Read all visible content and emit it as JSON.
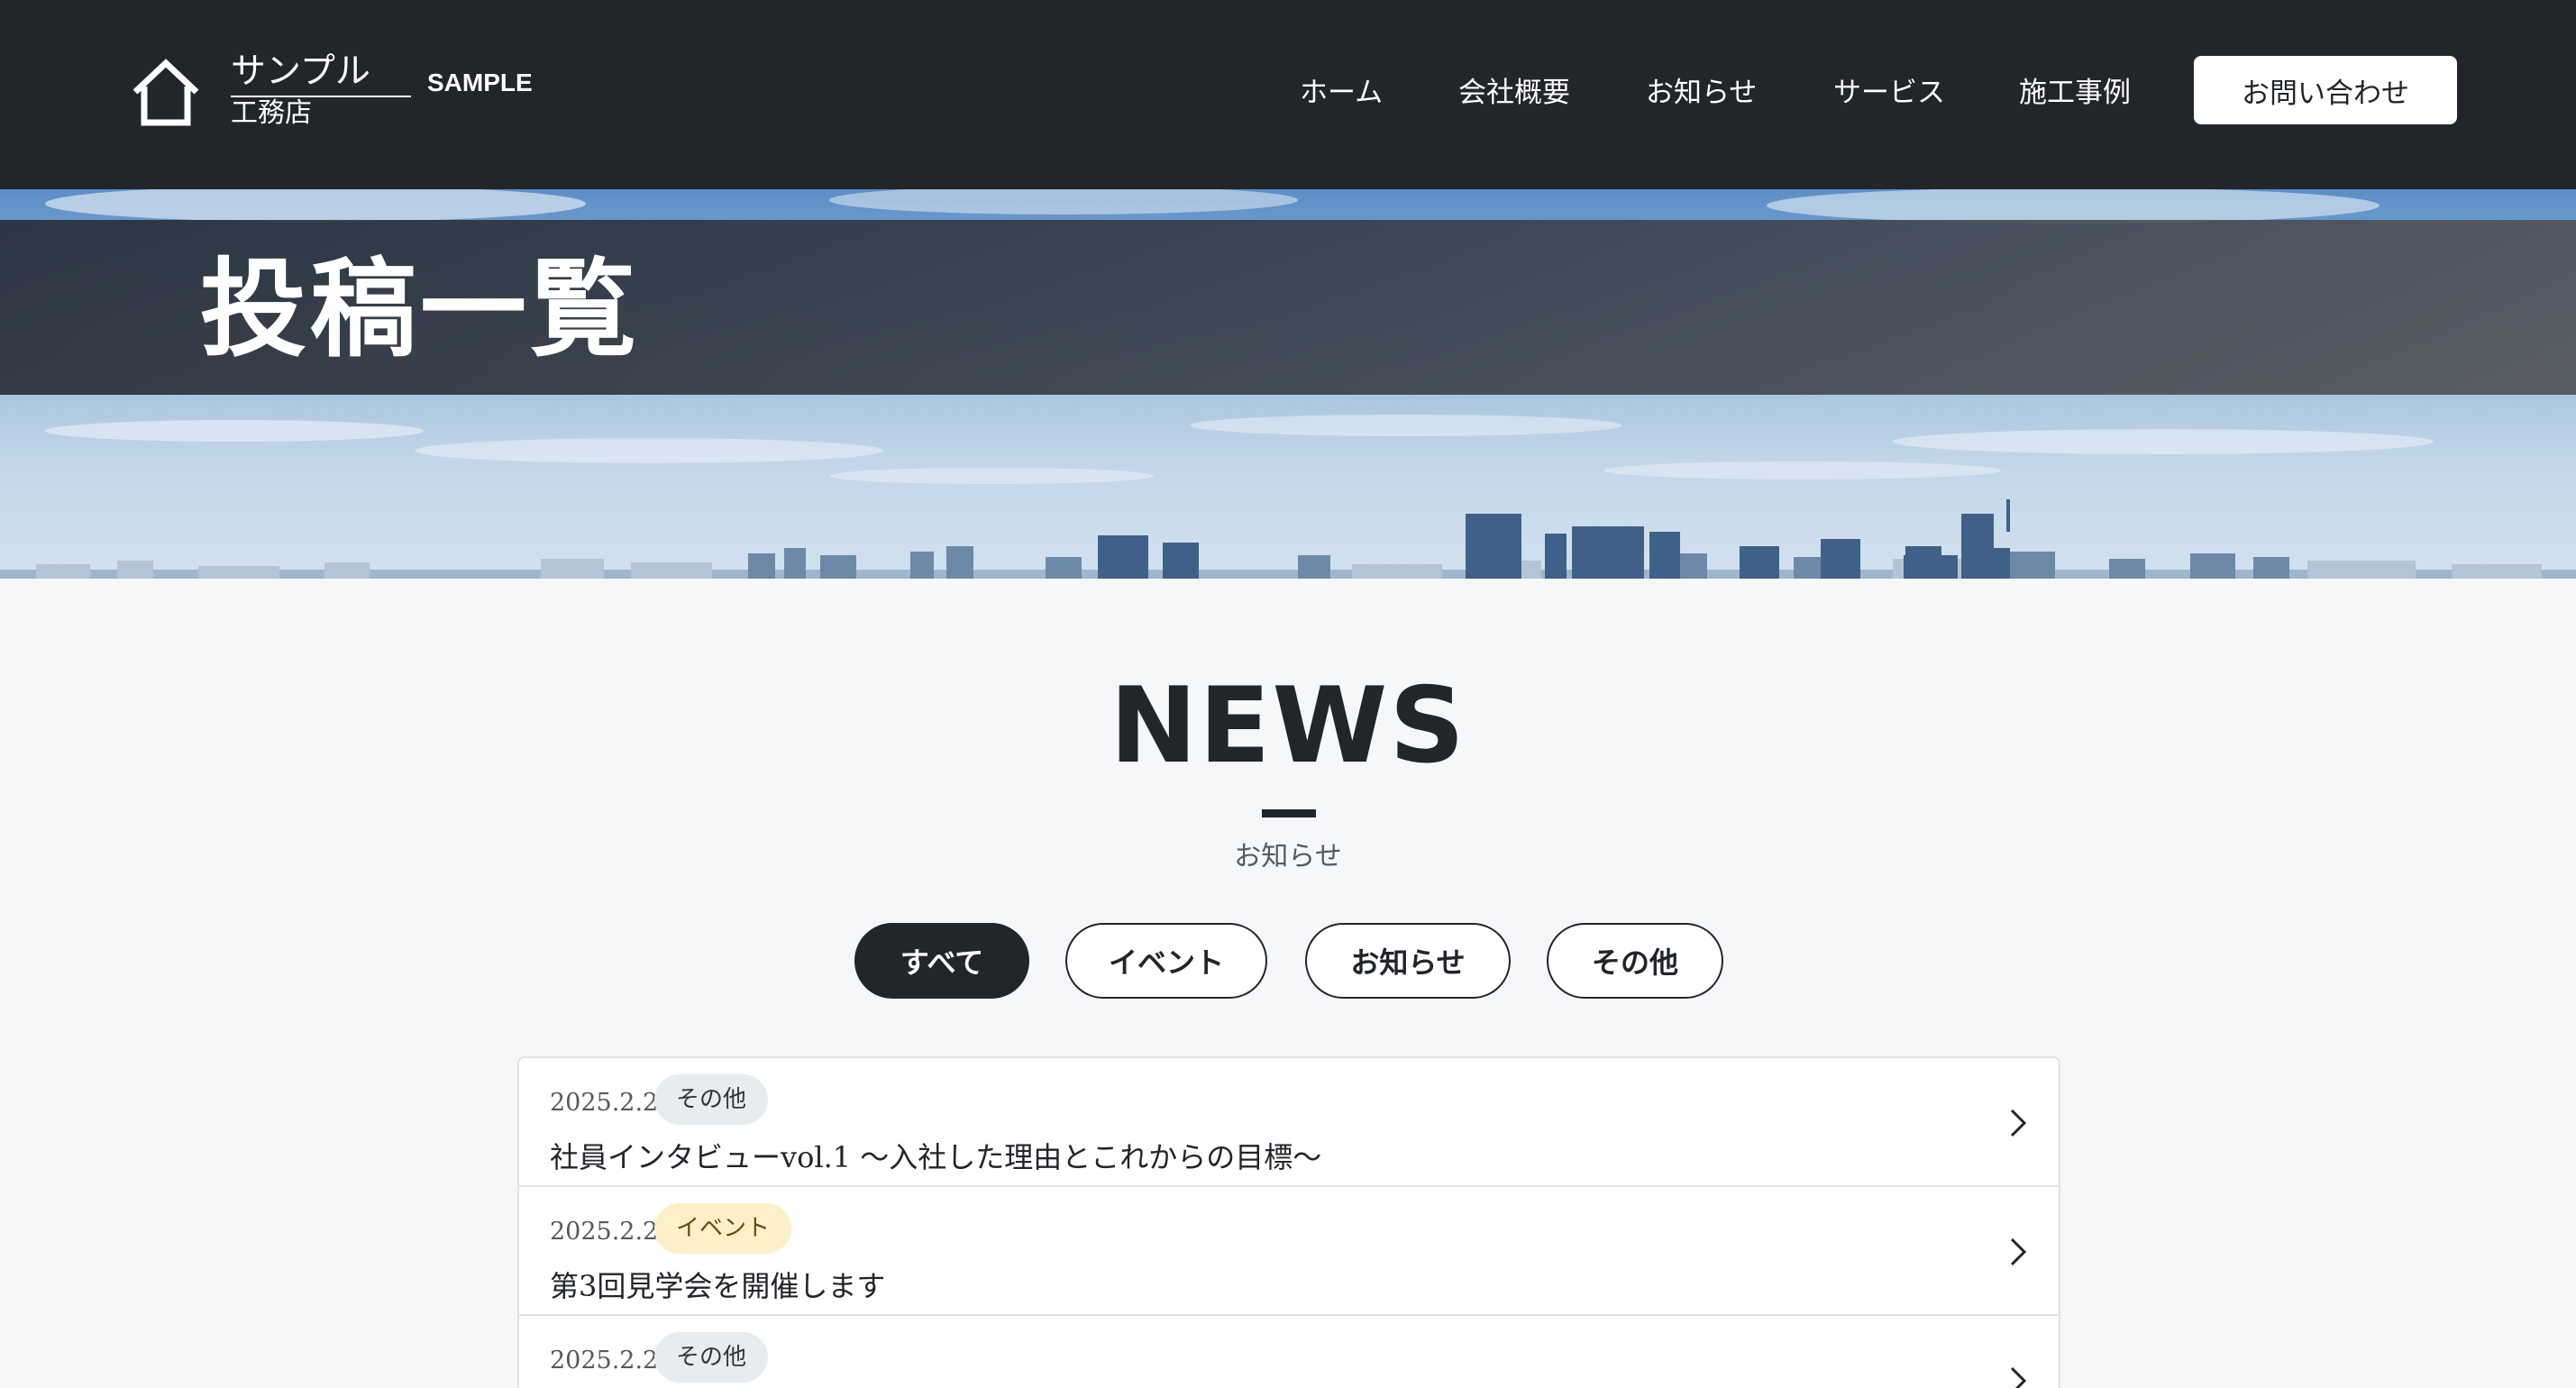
{
  "header": {
    "logo_main": "サンプル",
    "logo_sub": "工務店",
    "logo_en": "SAMPLE",
    "nav": [
      {
        "label": "ホーム"
      },
      {
        "label": "会社概要"
      },
      {
        "label": "お知らせ"
      },
      {
        "label": "サービス"
      },
      {
        "label": "施工事例"
      }
    ],
    "contact_label": "お問い合わせ",
    "logo_icon": "house-icon"
  },
  "hero": {
    "title": "投稿一覧"
  },
  "news": {
    "heading": "NEWS",
    "subheading": "お知らせ",
    "filters": [
      {
        "label": "すべて",
        "active": true
      },
      {
        "label": "イベント",
        "active": false
      },
      {
        "label": "お知らせ",
        "active": false
      },
      {
        "label": "その他",
        "active": false
      }
    ],
    "items": [
      {
        "date": "2025.2.2",
        "category": "その他",
        "title": "社員インタビューvol.1 〜入社した理由とこれからの目標〜"
      },
      {
        "date": "2025.2.2",
        "category": "イベント",
        "title": "第3回見学会を開催します"
      },
      {
        "date": "2025.2.2",
        "category": "その他",
        "title": ""
      }
    ],
    "chevron_icon": "chevron-right-icon"
  },
  "colors": {
    "header_bg": "#22252a",
    "page_bg": "#f6f7f9",
    "tag_event_bg": "#fdf0c9",
    "tag_other_bg": "#e9ecef"
  }
}
